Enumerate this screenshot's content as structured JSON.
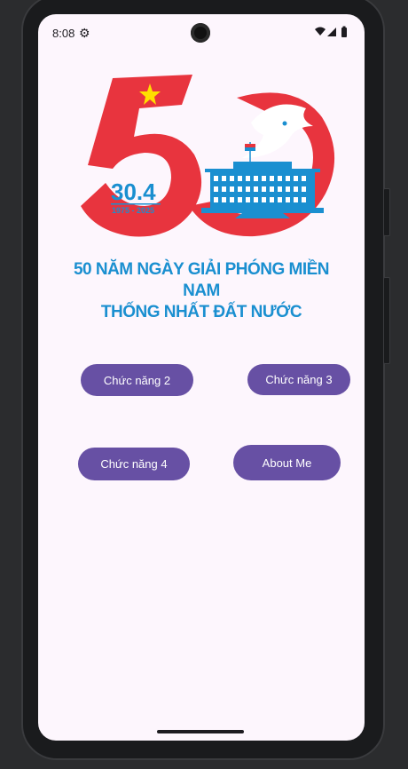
{
  "status_bar": {
    "time": "8:08",
    "icons": [
      "settings-icon",
      "wifi-icon",
      "signal-icon",
      "battery-icon"
    ]
  },
  "logo": {
    "big_number": "50",
    "date": "30.4",
    "years": "1975 - 2025"
  },
  "headline": {
    "line1": "50 NĂM NGÀY GIẢI PHÓNG MIỀN NAM",
    "line2": "THỐNG NHẤT ĐẤT NƯỚC"
  },
  "buttons": {
    "feature2": "Chức năng 2",
    "feature3": "Chức năng 3",
    "feature4": "Chức năng 4",
    "about": "About Me"
  },
  "colors": {
    "primary": "#6750a4",
    "background": "#fdf6fd",
    "logo_red": "#e8343e",
    "logo_blue": "#1a8fd0",
    "star_yellow": "#ffde00"
  }
}
